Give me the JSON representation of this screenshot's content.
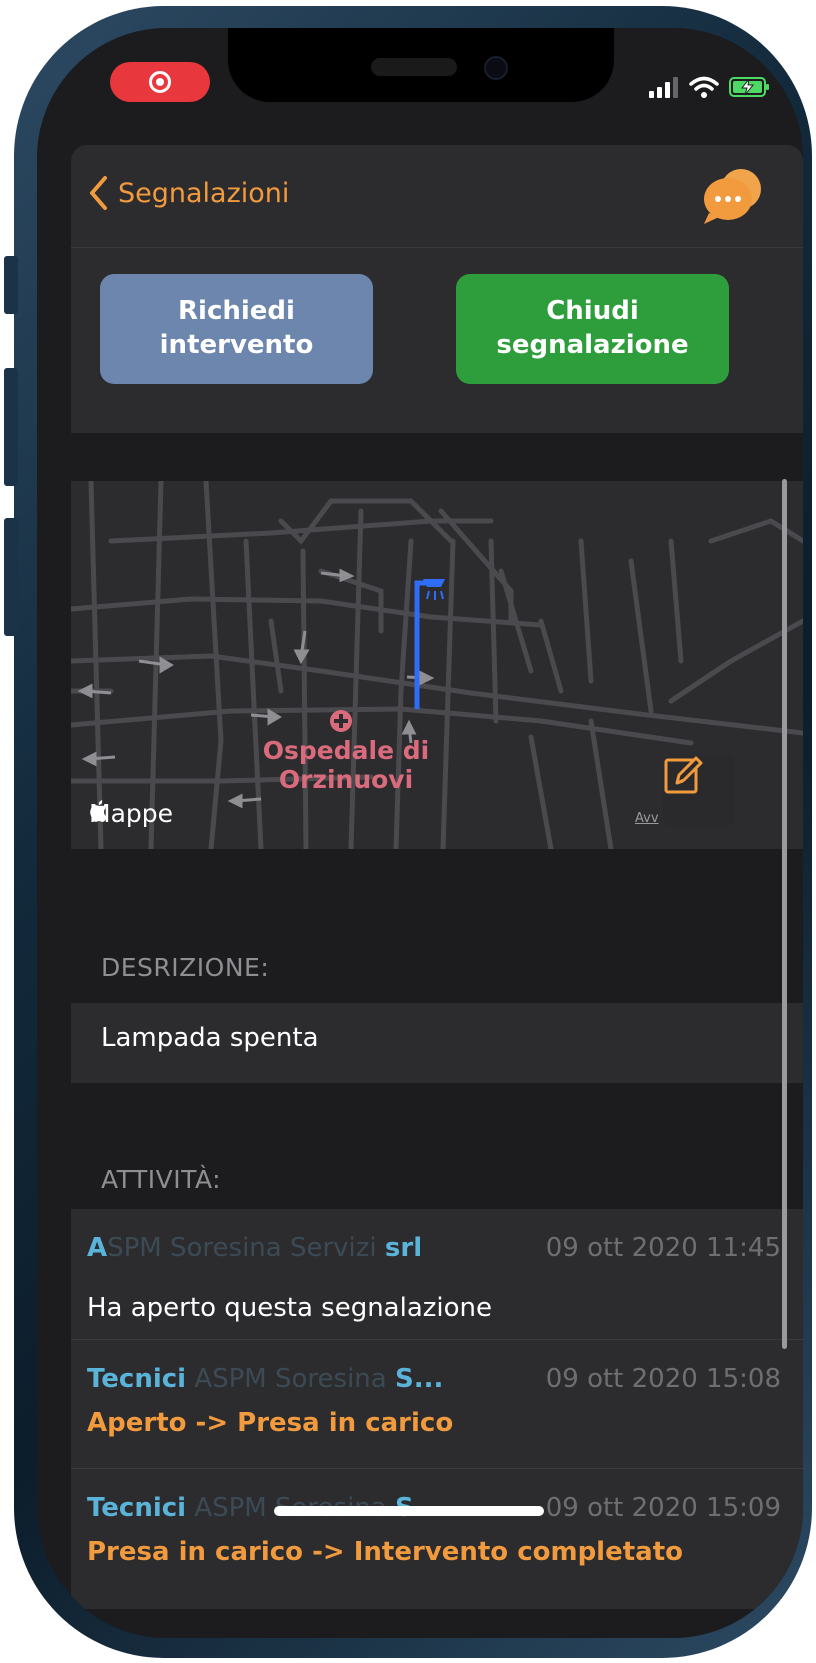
{
  "status_bar": {
    "record_icon": "screen-record-icon",
    "signal_icon": "cellular-signal-icon",
    "wifi_icon": "wifi-icon",
    "battery_icon": "battery-charging-icon"
  },
  "navbar": {
    "back_label": "Segnalazioni",
    "back_icon": "chevron-left-icon",
    "chat_icon": "chat-bubbles-icon"
  },
  "actions": {
    "request_label": "Richiedi intervento",
    "close_label": "Chiudi segnalazione"
  },
  "map": {
    "poi_label": "Ospedale di Orzinuovi",
    "poi_icon": "hospital-pin-icon",
    "maps_credit": "Mappe",
    "legal_link": "Avv",
    "edit_icon": "edit-note-icon"
  },
  "description": {
    "header": "DESRIZIONE:",
    "text": "Lampada spenta"
  },
  "activity": {
    "header": "ATTIVITÀ:",
    "items": [
      {
        "author_lead": "A",
        "author_faded": "SPM Soresina Servizi ",
        "author_tail": "srl",
        "time": "09 ott 2020 11:45",
        "text": "Ha aperto questa segnalazione"
      },
      {
        "author_lead": "Tecnici",
        "author_faded": " ASPM Soresina ",
        "author_tail": "S...",
        "time": "09 ott 2020 15:08",
        "text": "Aperto -> Presa in carico"
      },
      {
        "author_lead": "Tecnici",
        "author_faded": " ASPM Soresina ",
        "author_tail": "S...",
        "time": "09 ott 2020 15:09",
        "text": "Presa in carico -> Intervento completato"
      }
    ]
  },
  "colors": {
    "accent": "#f19a3e",
    "request_button": "#6d86ad",
    "close_button": "#2e9e3c",
    "author": "#5ab3d8",
    "background": "#1c1c1e",
    "cell": "#2c2c2e"
  }
}
